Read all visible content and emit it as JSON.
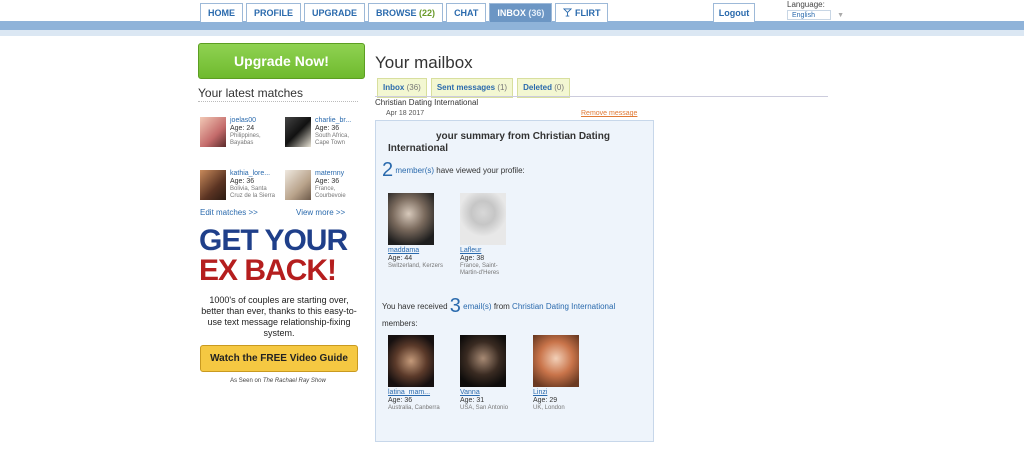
{
  "nav": {
    "tabs": [
      {
        "label": "HOME",
        "count": ""
      },
      {
        "label": "PROFILE",
        "count": ""
      },
      {
        "label": "UPGRADE",
        "count": ""
      },
      {
        "label": "BROWSE",
        "count": "(22)"
      },
      {
        "label": "CHAT",
        "count": ""
      },
      {
        "label": "INBOX",
        "count": "(36)"
      },
      {
        "label": "FLIRT",
        "count": "",
        "icon": "cocktail-icon"
      }
    ],
    "logout": "Logout",
    "language_label": "Language:",
    "language_value": "English"
  },
  "sidebar": {
    "upgrade_button": "Upgrade Now!",
    "matches_title": "Your latest matches",
    "matches": [
      {
        "name": "joelas00",
        "age": "Age: 24",
        "location": "Philippines, Bayabas"
      },
      {
        "name": "charlie_br...",
        "age": "Age: 36",
        "location": "South Africa, Cape Town"
      },
      {
        "name": "kathia_lore...",
        "age": "Age: 36",
        "location": "Bolivia, Santa Cruz de la Sierra"
      },
      {
        "name": "maternny",
        "age": "Age: 36",
        "location": "France, Courbevoie"
      }
    ],
    "edit_matches": "Edit matches >>",
    "view_more": "View more >>"
  },
  "ad": {
    "headline_1": "GET YOUR",
    "headline_2": "EX BACK!",
    "body": "1000's of couples are starting over, better than ever, thanks to this easy-to-use text message relationship-fixing system.",
    "button": "Watch the FREE Video Guide",
    "seen_on_prefix": "As Seen on",
    "seen_on_show": "The Rachael Ray Show"
  },
  "mailbox": {
    "title": "Your mailbox",
    "tabs": [
      {
        "label": "Inbox",
        "count": "(36)"
      },
      {
        "label": "Sent messages",
        "count": "(1)"
      },
      {
        "label": "Deleted",
        "count": "(0)"
      }
    ],
    "sender": "Christian Dating International",
    "date": "Apr 18 2017",
    "remove": "Remove message"
  },
  "summary": {
    "title": "your summary from Christian Dating International",
    "viewed_count": "2",
    "viewed_link": "member(s)",
    "viewed_text": "have viewed your profile:",
    "viewers": [
      {
        "name": "maddama",
        "age": "Age: 44",
        "location": "Switzerland, Kerzers"
      },
      {
        "name": "Lafleur",
        "age": "Age: 38",
        "location": "France, Saint-Martin-d'Heres"
      }
    ],
    "received_prefix": "You have received",
    "received_count": "3",
    "received_link": "email(s)",
    "received_from": "from",
    "received_sender": "Christian Dating International",
    "received_suffix": "members:",
    "senders": [
      {
        "name": "latina_mam...",
        "age": "Age: 36",
        "location": "Australia, Canberra"
      },
      {
        "name": "Vanna",
        "age": "Age: 31",
        "location": "USA, San Antonio"
      },
      {
        "name": "Linzi",
        "age": "Age: 29",
        "location": "UK, London"
      }
    ]
  }
}
